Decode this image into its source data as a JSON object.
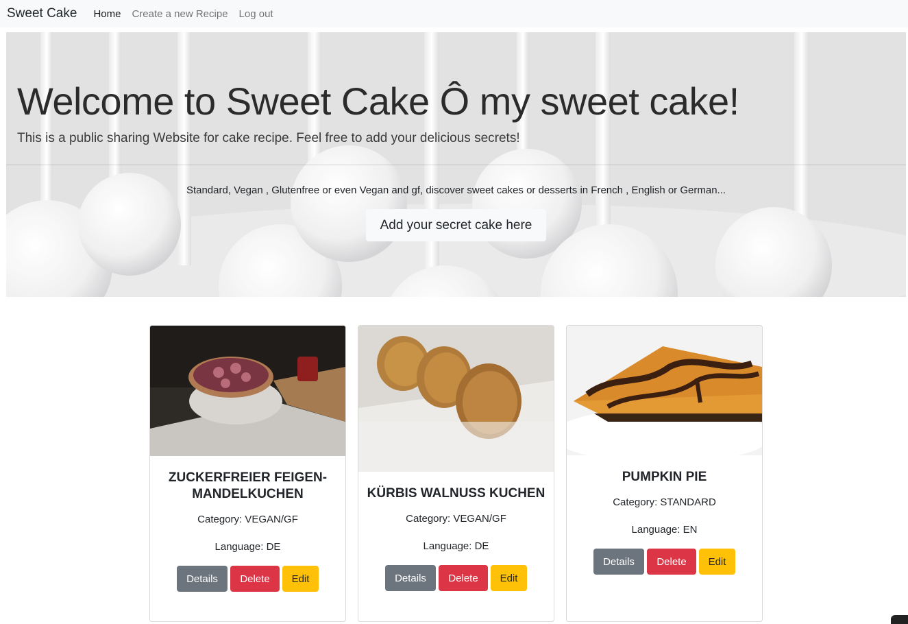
{
  "navbar": {
    "brand": "Sweet Cake",
    "links": [
      "Home",
      "Create a new Recipe",
      "Log out"
    ]
  },
  "hero": {
    "title": "Welcome to Sweet Cake Ô my sweet cake!",
    "lead": "This is a public sharing Website for cake recipe. Feel free to add your delicious secrets!",
    "description": "Standard, Vegan , Glutenfree or even Vegan and gf, discover sweet cakes or desserts in French , English or German...",
    "button": "Add your secret cake here"
  },
  "cards": [
    {
      "title": "Zuckerfreier Feigen-Mandelkuchen",
      "category": "Category: VEGAN/GF",
      "language": "Language: DE",
      "details": "Details",
      "delete": "Delete",
      "edit": "Edit"
    },
    {
      "title": "Kürbis Walnuss Kuchen",
      "category": "Category: VEGAN/GF",
      "language": "Language: DE",
      "details": "Details",
      "delete": "Delete",
      "edit": "Edit"
    },
    {
      "title": "Pumpkin Pie",
      "category": "Category: STANDARD",
      "language": "Language: EN",
      "details": "Details",
      "delete": "Delete",
      "edit": "Edit"
    }
  ],
  "colors": {
    "navbar_bg": "#f8f9fa",
    "details": "#6c757d",
    "delete": "#dc3545",
    "edit": "#ffc107"
  }
}
